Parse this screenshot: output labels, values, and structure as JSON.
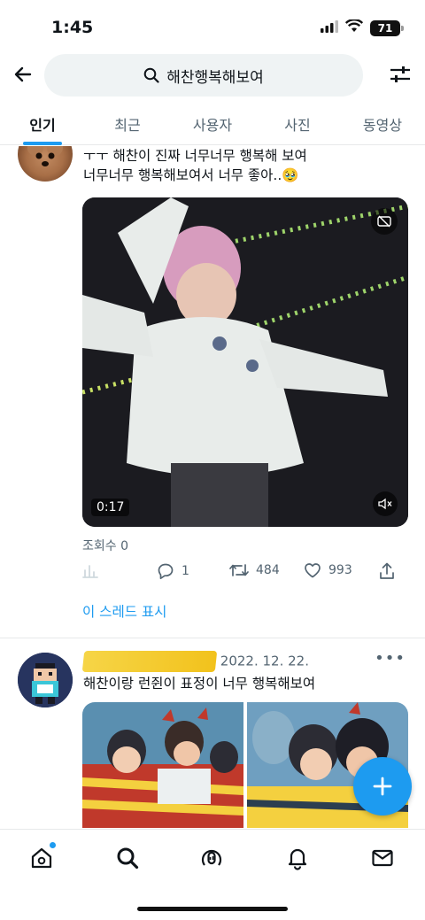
{
  "status_bar": {
    "time": "1:45",
    "battery": "71"
  },
  "search": {
    "query": "해찬행복해보여"
  },
  "tabs": [
    {
      "label": "인기"
    },
    {
      "label": "최근"
    },
    {
      "label": "사용자"
    },
    {
      "label": "사진"
    },
    {
      "label": "동영상"
    }
  ],
  "tweet1": {
    "line1": "ㅜㅜ 해찬이 진짜 너무너무 행복해 보여",
    "line2": "너무너무 행복해보여서 너무 좋아..🥹",
    "video_duration": "0:17",
    "views": "조회수 0",
    "replies": "1",
    "retweets": "484",
    "likes": "993",
    "show_thread": "이 스레드 표시"
  },
  "tweet2": {
    "date": "2022. 12. 22.",
    "text": "해찬이랑 런쥔이 표정이 너무 행복해보여"
  },
  "colors": {
    "accent": "#1d9bf0",
    "text_secondary": "#536471"
  }
}
